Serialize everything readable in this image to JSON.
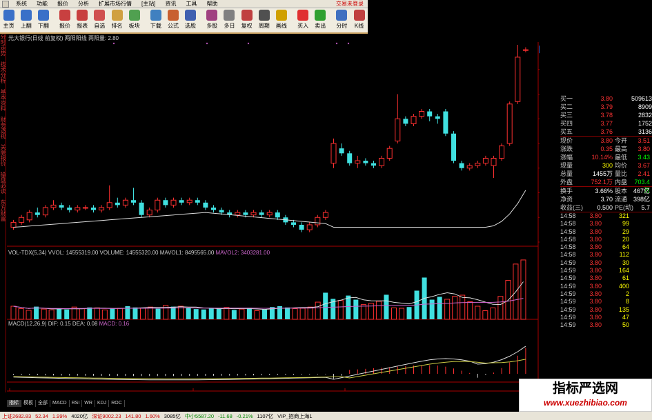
{
  "menubar": {
    "items": [
      "系统",
      "功能",
      "报价",
      "分析",
      "扩展市场行情",
      "[主站]",
      "资讯",
      "工具",
      "帮助"
    ],
    "login": "交易未登录"
  },
  "toolbar": {
    "buttons": [
      {
        "label": "主页",
        "color": "#3a70c8"
      },
      {
        "label": "上翻",
        "color": "#3a70c8"
      },
      {
        "label": "下翻",
        "color": "#3a70c8"
      },
      {
        "label": "报价",
        "color": "#c84040"
      },
      {
        "label": "报表",
        "color": "#c84040"
      },
      {
        "label": "自选",
        "color": "#d05050"
      },
      {
        "label": "排名",
        "color": "#d0a040"
      },
      {
        "label": "板块",
        "color": "#50a050"
      },
      {
        "label": "下载",
        "color": "#4080c0"
      },
      {
        "label": "公式",
        "color": "#c86030"
      },
      {
        "label": "选股",
        "color": "#4060b0"
      },
      {
        "label": "多股",
        "color": "#a04080"
      },
      {
        "label": "多日",
        "color": "#808080"
      },
      {
        "label": "复权",
        "color": "#c04040"
      },
      {
        "label": "周期",
        "color": "#505050"
      },
      {
        "label": "画线",
        "color": "#d0a000"
      },
      {
        "label": "买入",
        "color": "#e03030"
      },
      {
        "label": "卖出",
        "color": "#30a030"
      },
      {
        "label": "分时",
        "color": "#4070c0"
      },
      {
        "label": "K线",
        "color": "#c04040"
      }
    ]
  },
  "left_tabs": [
    "分时走势",
    "技术分析",
    "基本资料",
    "财务透视",
    "关联报价",
    "操盘必读",
    "东方财富"
  ],
  "main_chart": {
    "title": "光大银行(日线 前复权)  两阳阳线 两阳量: 2.80",
    "price_labels": [
      "3.30",
      "3.20",
      "3.10",
      "3.00",
      "2.90",
      "2.80",
      "2.70",
      "2.60"
    ],
    "current_price_tag": "3.38"
  },
  "volume_panel": {
    "title_parts": [
      {
        "text": "VOL-TDX(5,34) VVOL: 14555319.00  VOLUME: 14555320.00  MAVOL1: 8495565.00 ",
        "color": "#cccccc"
      },
      {
        "text": "MAVOL2: 3403281.00",
        "color": "#cc66cc"
      }
    ],
    "labels": [
      "15000",
      "10000",
      "5000",
      "X1000"
    ]
  },
  "macd_panel": {
    "title_parts": [
      {
        "text": "MACD(12,26,9)  DIF: 0.15  DEA: 0.08 ",
        "color": "#cccccc"
      },
      {
        "text": "MACD: 0.16",
        "color": "#cc66cc"
      }
    ],
    "labels": [
      "0.15",
      "0.10",
      "0.05",
      "0.00"
    ]
  },
  "date_axis": [
    "2014年",
    "10",
    "11"
  ],
  "bottom_tabs": [
    "指标",
    "模板",
    "全部",
    "MACD",
    "RSI",
    "WR",
    "KDJ",
    "ROC"
  ],
  "quote_panel": {
    "book": [
      {
        "label": "买一",
        "price": "3.80",
        "vol": "509613"
      },
      {
        "label": "买二",
        "price": "3.79",
        "vol": "8909"
      },
      {
        "label": "买三",
        "price": "3.78",
        "vol": "2832"
      },
      {
        "label": "买四",
        "price": "3.77",
        "vol": "1752"
      },
      {
        "label": "买五",
        "price": "3.76",
        "vol": "3136"
      }
    ],
    "stats": [
      {
        "a": "现价",
        "b": "3.80",
        "bc": "red",
        "c": "今开",
        "d": "3.51",
        "dc": "red"
      },
      {
        "a": "涨跌",
        "b": "0.35",
        "bc": "red",
        "c": "最高",
        "d": "3.80",
        "dc": "red"
      },
      {
        "a": "涨幅",
        "b": "10.14%",
        "bc": "red",
        "c": "最低",
        "d": "3.43",
        "dc": "green"
      },
      {
        "a": "现量",
        "b": "300",
        "bc": "yellow",
        "c": "均价",
        "d": "3.67",
        "dc": "red"
      },
      {
        "a": "总量",
        "b": "1455万",
        "bc": "white",
        "c": "量比",
        "d": "2.41",
        "dc": "red"
      },
      {
        "a": "外盘",
        "b": "752.1万",
        "bc": "red",
        "c": "内盘",
        "d": "703.4万",
        "dc": "green"
      },
      {
        "a": "换手",
        "b": "3.66%",
        "bc": "white",
        "c": "股本",
        "d": "467亿",
        "dc": "white"
      },
      {
        "a": "净资",
        "b": "3.70",
        "bc": "white",
        "c": "流通",
        "d": "398亿",
        "dc": "white"
      },
      {
        "a": "收益(三)",
        "b": "0.500",
        "bc": "white",
        "c": "PE(动)",
        "d": "5.7",
        "dc": "white"
      }
    ],
    "ticks": [
      {
        "t": "14:58",
        "p": "3.80",
        "v": "321"
      },
      {
        "t": "14:58",
        "p": "3.80",
        "v": "99"
      },
      {
        "t": "14:58",
        "p": "3.80",
        "v": "29"
      },
      {
        "t": "14:58",
        "p": "3.80",
        "v": "20"
      },
      {
        "t": "14:58",
        "p": "3.80",
        "v": "64"
      },
      {
        "t": "14:58",
        "p": "3.80",
        "v": "112"
      },
      {
        "t": "14:59",
        "p": "3.80",
        "v": "30"
      },
      {
        "t": "14:59",
        "p": "3.80",
        "v": "164"
      },
      {
        "t": "14:59",
        "p": "3.80",
        "v": "61"
      },
      {
        "t": "14:59",
        "p": "3.80",
        "v": "400"
      },
      {
        "t": "14:59",
        "p": "3.80",
        "v": "2"
      },
      {
        "t": "14:59",
        "p": "3.80",
        "v": "8"
      },
      {
        "t": "14:59",
        "p": "3.80",
        "v": "135"
      },
      {
        "t": "14:59",
        "p": "3.80",
        "v": "47"
      },
      {
        "t": "14:59",
        "p": "3.80",
        "v": "50"
      }
    ]
  },
  "statusbar": {
    "items": [
      {
        "text": "上证2682.83",
        "color": "#c00"
      },
      {
        "text": "52.34",
        "color": "#c00"
      },
      {
        "text": "1.99%",
        "color": "#c00"
      },
      {
        "text": "4020亿",
        "color": "#000"
      },
      {
        "text": "深证9002.23",
        "color": "#c00"
      },
      {
        "text": "141.80",
        "color": "#c00"
      },
      {
        "text": "1.60%",
        "color": "#c00"
      },
      {
        "text": "3085亿",
        "color": "#000"
      },
      {
        "text": "中小5587.20",
        "color": "#080"
      },
      {
        "text": "-11.68",
        "color": "#080"
      },
      {
        "text": "-0.21%",
        "color": "#080"
      },
      {
        "text": "1107亿",
        "color": "#000"
      },
      {
        "text": "VIP_招商上海1",
        "color": "#000"
      }
    ]
  },
  "watermark": {
    "line1": "指标严选网",
    "line2": "www.xuezhibiao.com"
  },
  "candles": [
    [
      2.66,
      2.68,
      2.65,
      2.69
    ],
    [
      2.68,
      2.7,
      2.67,
      2.71
    ],
    [
      2.69,
      2.72,
      2.68,
      2.73
    ],
    [
      2.72,
      2.71,
      2.7,
      2.74
    ],
    [
      2.71,
      2.74,
      2.7,
      2.75
    ],
    [
      2.74,
      2.75,
      2.73,
      2.77
    ],
    [
      2.75,
      2.74,
      2.73,
      2.76
    ],
    [
      2.74,
      2.73,
      2.72,
      2.75
    ],
    [
      2.73,
      2.74,
      2.72,
      2.75
    ],
    [
      2.74,
      2.74,
      2.73,
      2.75
    ],
    [
      2.74,
      2.73,
      2.72,
      2.75
    ],
    [
      2.73,
      2.74,
      2.72,
      2.75
    ],
    [
      2.74,
      2.76,
      2.73,
      2.83
    ],
    [
      2.76,
      2.75,
      2.74,
      2.78
    ],
    [
      2.75,
      2.77,
      2.74,
      2.78
    ],
    [
      2.77,
      2.76,
      2.75,
      2.82
    ],
    [
      2.76,
      2.71,
      2.7,
      2.77
    ],
    [
      2.71,
      2.73,
      2.7,
      2.74
    ],
    [
      2.73,
      2.77,
      2.72,
      2.78
    ],
    [
      2.77,
      2.75,
      2.74,
      2.78
    ],
    [
      2.75,
      2.77,
      2.74,
      2.78
    ],
    [
      2.77,
      2.76,
      2.75,
      2.78
    ],
    [
      2.76,
      2.77,
      2.75,
      2.78
    ],
    [
      2.77,
      2.76,
      2.75,
      2.78
    ],
    [
      2.76,
      2.74,
      2.73,
      2.77
    ],
    [
      2.74,
      2.73,
      2.72,
      2.75
    ],
    [
      2.73,
      2.72,
      2.71,
      2.74
    ],
    [
      2.72,
      2.71,
      2.7,
      2.73
    ],
    [
      2.71,
      2.72,
      2.7,
      2.73
    ],
    [
      2.72,
      2.71,
      2.7,
      2.73
    ],
    [
      2.71,
      2.72,
      2.7,
      2.73
    ],
    [
      2.72,
      2.71,
      2.7,
      2.73
    ],
    [
      2.71,
      2.72,
      2.7,
      2.73
    ],
    [
      2.72,
      2.7,
      2.69,
      2.73
    ],
    [
      2.7,
      2.68,
      2.67,
      2.71
    ],
    [
      2.68,
      2.67,
      2.66,
      2.69
    ],
    [
      2.67,
      2.65,
      2.64,
      2.68
    ],
    [
      2.65,
      2.67,
      2.64,
      2.68
    ],
    [
      2.67,
      2.7,
      2.66,
      2.71
    ],
    [
      2.7,
      2.72,
      2.69,
      2.73
    ],
    [
      2.92,
      3.0,
      2.9,
      3.02
    ],
    [
      2.98,
      2.96,
      2.95,
      3.0
    ],
    [
      2.96,
      2.92,
      2.91,
      2.97
    ],
    [
      2.92,
      2.93,
      2.9,
      2.95
    ],
    [
      2.93,
      2.92,
      2.91,
      2.94
    ],
    [
      2.92,
      2.91,
      2.9,
      2.93
    ],
    [
      2.91,
      2.94,
      2.9,
      2.95
    ],
    [
      2.94,
      2.98,
      2.93,
      2.99
    ],
    [
      3.01,
      3.1,
      3.0,
      3.2
    ],
    [
      3.1,
      3.08,
      3.07,
      3.11
    ],
    [
      3.08,
      3.11,
      3.07,
      3.12
    ],
    [
      3.11,
      3.13,
      3.1,
      3.14
    ],
    [
      3.13,
      3.11,
      3.09,
      3.14
    ],
    [
      3.11,
      3.1,
      3.08,
      3.12
    ],
    [
      3.13,
      3.04,
      3.03,
      3.14
    ],
    [
      3.04,
      2.93,
      2.92,
      3.05
    ],
    [
      2.92,
      2.9,
      2.89,
      2.93
    ],
    [
      2.9,
      2.91,
      2.89,
      2.92
    ],
    [
      2.91,
      2.92,
      2.9,
      2.93
    ],
    [
      2.92,
      2.94,
      2.91,
      2.95
    ],
    [
      2.91,
      2.94,
      2.86,
      2.95
    ],
    [
      2.94,
      2.99,
      2.93,
      3.0
    ],
    [
      3.0,
      3.16,
      2.99,
      3.17
    ],
    [
      3.17,
      3.35,
      3.16,
      3.4
    ],
    [
      3.38,
      3.38,
      3.37,
      3.39
    ]
  ],
  "volumes": [
    3.2,
    2.6,
    2.2,
    3.1,
    2.5,
    2.3,
    2.6,
    2.4,
    3.0,
    2.6,
    2.9,
    2.8,
    2.3,
    2.6,
    2.7,
    3.2,
    2.9,
    2.7,
    3.0,
    2.6,
    3.4,
    3.1,
    3.2,
    2.7,
    2.5,
    2.4,
    2.8,
    2.6,
    2.9,
    2.3,
    2.5,
    2.8,
    2.1,
    2.4,
    3.0,
    3.2,
    2.9,
    2.6,
    2.7,
    3.0,
    4.2,
    6.5,
    5.0,
    4.6,
    5.8,
    4.8,
    3.6,
    3.9,
    4.4,
    6.0,
    2.8,
    2.7,
    3.0,
    7.0,
    10.2,
    4.8,
    5.5,
    4.9,
    5.6,
    5.9,
    4.3,
    3.2,
    2.1,
    2.8,
    5.6,
    9.5,
    13.5,
    14.5
  ]
}
